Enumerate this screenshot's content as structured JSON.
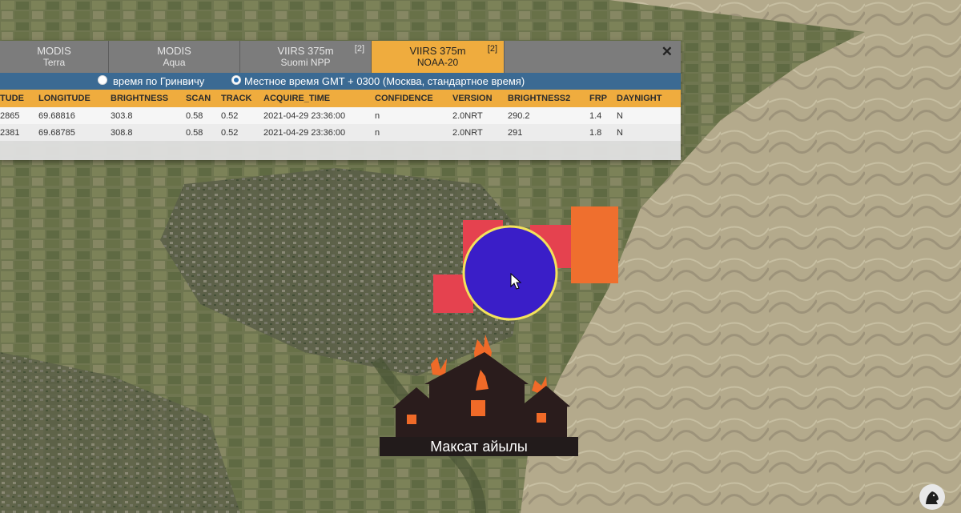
{
  "tabs": [
    {
      "line1": "MODIS",
      "line2": "Terra",
      "count": "",
      "active": false
    },
    {
      "line1": "MODIS",
      "line2": "Aqua",
      "count": "",
      "active": false
    },
    {
      "line1": "VIIRS 375m",
      "line2": "Suomi NPP",
      "count": "[2]",
      "active": false
    },
    {
      "line1": "VIIRS 375m",
      "line2": "NOAA-20",
      "count": "[2]",
      "active": true
    }
  ],
  "close_label": "✕",
  "time_options": {
    "greenwich": "время по Гринвичу",
    "local": "Местное время GMT + 0300 (Москва, стандартное время)",
    "selected": "local"
  },
  "table": {
    "columns": [
      "TUDE",
      "LONGITUDE",
      "BRIGHTNESS",
      "SCAN",
      "TRACK",
      "ACQUIRE_TIME",
      "CONFIDENCE",
      "VERSION",
      "BRIGHTNESS2",
      "FRP",
      "DAYNIGHT"
    ],
    "rows": [
      [
        "2865",
        "69.68816",
        "303.8",
        "0.58",
        "0.52",
        "2021-04-29 23:36:00",
        "n",
        "2.0NRT",
        "290.2",
        "1.4",
        "N"
      ],
      [
        "2381",
        "69.68785",
        "308.8",
        "0.58",
        "0.52",
        "2021-04-29 23:36:00",
        "n",
        "2.0NRT",
        "291",
        "1.8",
        "N"
      ]
    ]
  },
  "village_label": "Максат айылы",
  "colors": {
    "tab_active": "#efac3e",
    "header_bar": "#efac3e",
    "time_bar": "#3b6a93",
    "fire_red": "#e5424f",
    "fire_orange": "#ef6f2e",
    "selection_circle": "#3a1ec8",
    "selection_ring": "#f3e25b"
  },
  "icons": [
    "close-icon",
    "cursor-icon",
    "burning-houses-icon",
    "channel-logo-icon"
  ]
}
